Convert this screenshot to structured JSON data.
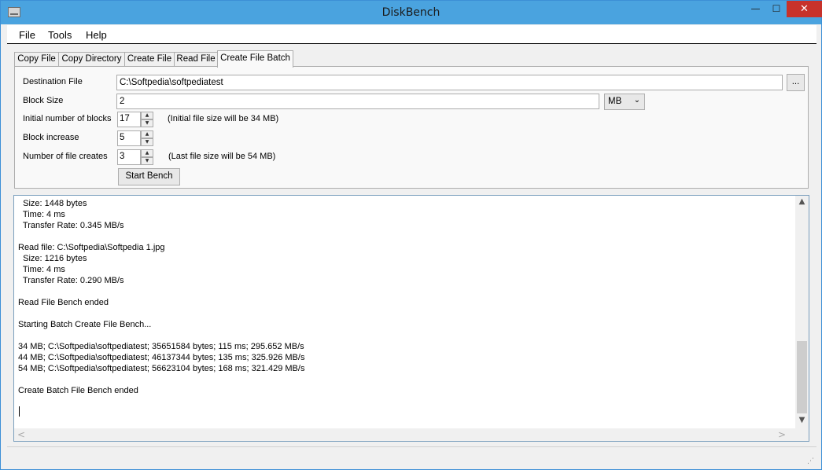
{
  "window": {
    "title": "DiskBench",
    "icon": "disk-icon",
    "controls": {
      "minimize": "—",
      "maximize": "☐",
      "close": "✕"
    }
  },
  "menu": {
    "items": [
      "File",
      "Tools",
      "Help"
    ]
  },
  "tabs": {
    "items": [
      "Copy File",
      "Copy Directory",
      "Create File",
      "Read File",
      "Create File Batch"
    ],
    "active": "Create File Batch"
  },
  "form": {
    "destination_label": "Destination File",
    "destination_value": "C:\\Softpedia\\softpediatest",
    "browse_label": "...",
    "block_size_label": "Block Size",
    "block_size_value": "2",
    "unit_value": "MB",
    "initial_blocks_label": "Initial number of blocks",
    "initial_blocks_value": "17",
    "initial_note": "(Initial file size will be 34 MB)",
    "block_increase_label": "Block increase",
    "block_increase_value": "5",
    "file_creates_label": "Number of file creates",
    "file_creates_value": "3",
    "file_creates_note": "(Last file size will be 54 MB)",
    "start_label": "Start Bench"
  },
  "log": {
    "lines": [
      "  Size: 1448 bytes",
      "  Time: 4 ms",
      "  Transfer Rate: 0.345 MB/s",
      "",
      "Read file: C:\\Softpedia\\Softpedia 1.jpg",
      "  Size: 1216 bytes",
      "  Time: 4 ms",
      "  Transfer Rate: 0.290 MB/s",
      "",
      "Read File Bench ended",
      "",
      "Starting Batch Create File Bench...",
      "",
      "34 MB; C:\\Softpedia\\softpediatest; 35651584 bytes; 115 ms; 295.652 MB/s",
      "44 MB; C:\\Softpedia\\softpediatest; 46137344 bytes; 135 ms; 325.926 MB/s",
      "54 MB; C:\\Softpedia\\softpediatest; 56623104 bytes; 168 ms; 321.429 MB/s",
      "",
      "Create Batch File Bench ended"
    ]
  },
  "scroll": {
    "up": "▲",
    "down": "▼",
    "left": "<",
    "right": ">"
  },
  "colors": {
    "titlebar": "#4aa3df",
    "close": "#c7322b",
    "log_border": "#7a9ebd"
  }
}
